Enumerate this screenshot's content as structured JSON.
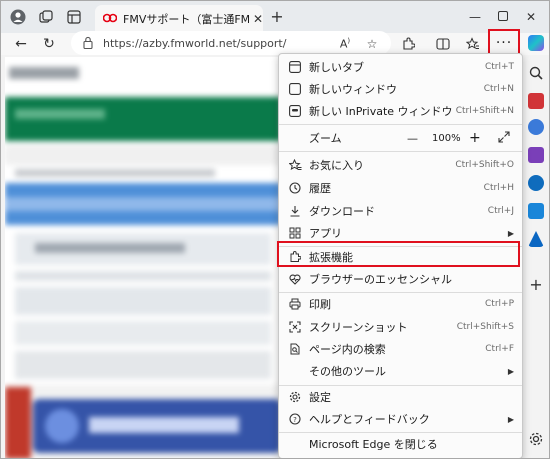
{
  "tab": {
    "title": "FMVサポート（富士通FMV個人向"
  },
  "address": {
    "url": "https://azby.fmworld.net/support/"
  },
  "nav": {
    "more_label": "···"
  },
  "zoom": {
    "label": "ズーム",
    "minus": "—",
    "value": "100%",
    "plus": "+"
  },
  "menu": {
    "items": [
      {
        "label": "新しいタブ",
        "shortcut": "Ctrl+T",
        "icon": "new-tab-icon"
      },
      {
        "label": "新しいウィンドウ",
        "shortcut": "Ctrl+N",
        "icon": "new-window-icon"
      },
      {
        "label": "新しい InPrivate ウィンドウ",
        "shortcut": "Ctrl+Shift+N",
        "icon": "inprivate-icon"
      },
      {
        "label": "お気に入り",
        "shortcut": "Ctrl+Shift+O",
        "icon": "favorites-icon"
      },
      {
        "label": "履歴",
        "shortcut": "Ctrl+H",
        "icon": "history-icon"
      },
      {
        "label": "ダウンロード",
        "shortcut": "Ctrl+J",
        "icon": "download-icon"
      },
      {
        "label": "アプリ",
        "shortcut": "",
        "icon": "apps-icon"
      },
      {
        "label": "拡張機能",
        "shortcut": "",
        "icon": "extensions-icon"
      },
      {
        "label": "ブラウザーのエッセンシャル",
        "shortcut": "",
        "icon": "essentials-icon"
      },
      {
        "label": "印刷",
        "shortcut": "Ctrl+P",
        "icon": "print-icon"
      },
      {
        "label": "スクリーンショット",
        "shortcut": "Ctrl+Shift+S",
        "icon": "screenshot-icon"
      },
      {
        "label": "ページ内の検索",
        "shortcut": "Ctrl+F",
        "icon": "find-icon"
      },
      {
        "label": "その他のツール",
        "shortcut": "",
        "icon": "more-tools-icon"
      },
      {
        "label": "設定",
        "shortcut": "",
        "icon": "settings-icon"
      },
      {
        "label": "ヘルプとフィードバック",
        "shortcut": "",
        "icon": "help-icon"
      },
      {
        "label": "Microsoft Edge を閉じる",
        "shortcut": "",
        "icon": "close-edge-icon"
      }
    ]
  },
  "colors": {
    "highlight": "#e0101e",
    "tab_brand": "#e60012",
    "copilot": "#2f7bf5"
  }
}
